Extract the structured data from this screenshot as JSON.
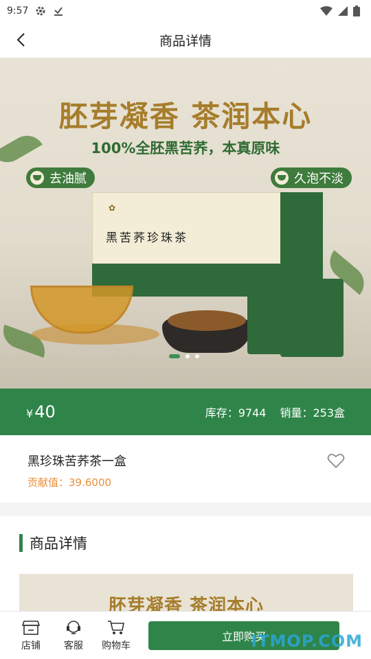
{
  "status_bar": {
    "time": "9:57"
  },
  "nav": {
    "title": "商品详情"
  },
  "hero": {
    "title": "胚芽凝香 茶润本心",
    "subtitle": "100%全胚黑苦荞，本真原味",
    "tag_left": "去油腻",
    "tag_right": "久泡不淡",
    "box_name": "黑苦荞珍珠茶",
    "slide_count": 3,
    "active_slide": 1
  },
  "price_bar": {
    "currency": "¥",
    "price": "40",
    "stock": "库存：9744",
    "sales": "销量：253盒"
  },
  "product": {
    "name": "黑珍珠苦荞茶一盒",
    "contribution": "贡献值：39.6000"
  },
  "detail": {
    "heading": "商品详情",
    "image_title": "胚芽凝香 茶润本心"
  },
  "bottom_bar": {
    "tabs": [
      {
        "label": "店铺",
        "icon": "store-icon"
      },
      {
        "label": "客服",
        "icon": "headset-icon"
      },
      {
        "label": "购物车",
        "icon": "cart-icon"
      }
    ],
    "buy_label": "立即购买"
  },
  "watermark": "ITMOP.COM",
  "colors": {
    "brand_green": "#2f8549",
    "accent_orange": "#e98f3a",
    "gold": "#a67d2b"
  }
}
